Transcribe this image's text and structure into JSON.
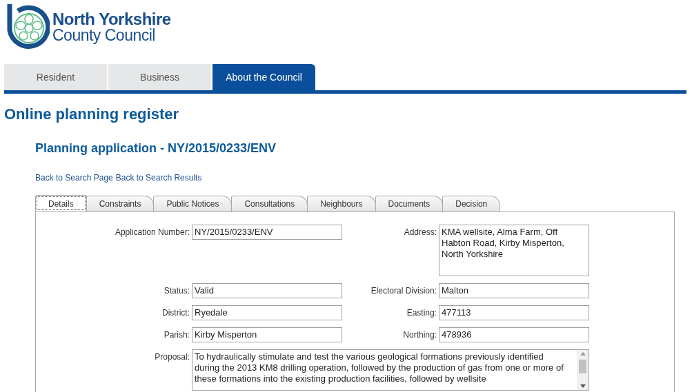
{
  "logo": {
    "line_1": "North Yorkshire",
    "line_2": "County Council"
  },
  "nav": [
    {
      "label": "Resident",
      "selected": false
    },
    {
      "label": "Business",
      "selected": false
    },
    {
      "label": "About the Council",
      "selected": true
    }
  ],
  "page_title": "Online planning register",
  "heading": "Planning application - NY/2015/0233/ENV",
  "links": [
    "Back to Search Page",
    "Back to Search Results"
  ],
  "tabs": [
    {
      "label": "Details",
      "selected": true
    },
    {
      "label": "Constraints",
      "selected": false
    },
    {
      "label": "Public Notices",
      "selected": false
    },
    {
      "label": "Consultations",
      "selected": false
    },
    {
      "label": "Neighbours",
      "selected": false
    },
    {
      "label": "Documents",
      "selected": false
    },
    {
      "label": "Decision",
      "selected": false
    }
  ],
  "fields": [
    {
      "label": "Application Number:",
      "value": "NY/2015/0233/ENV",
      "kind": "input"
    },
    {
      "label": "Address:",
      "value": "KMA wellsite, Alma Farm, Off Habton Road, Kirby Misperton, North Yorkshire",
      "kind": "textarea"
    },
    {
      "label": "Status:",
      "value": "Valid",
      "kind": "input"
    },
    {
      "label": "Electoral Division:",
      "value": "Malton",
      "kind": "input"
    },
    {
      "label": "District:",
      "value": "Ryedale",
      "kind": "input"
    },
    {
      "label": "Easting:",
      "value": "477113",
      "kind": "input"
    },
    {
      "label": "Parish:",
      "value": "Kirby Misperton",
      "kind": "input"
    },
    {
      "label": "Northing:",
      "value": "478936",
      "kind": "input"
    }
  ],
  "proposal": {
    "label": "Proposal:",
    "value": "To hydraulically stimulate and test the various geological formations previously identified during the 2013 KM8 drilling operation, followed by the production of gas from one or more of these formations into the existing production facilities, followed by wellsite"
  }
}
